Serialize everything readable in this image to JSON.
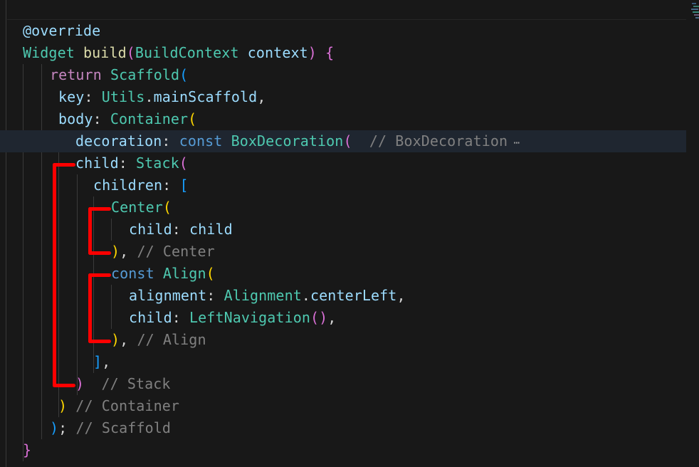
{
  "editor": {
    "language": "dart",
    "lines": [
      {
        "tokens": [
          {
            "t": "@override",
            "c": "ann"
          }
        ]
      },
      {
        "tokens": [
          {
            "t": "Widget",
            "c": "ty"
          },
          {
            "t": " ",
            "c": "pl"
          },
          {
            "t": "build",
            "c": "fn"
          },
          {
            "t": "(",
            "c": "b2"
          },
          {
            "t": "BuildContext",
            "c": "ty"
          },
          {
            "t": " ",
            "c": "pl"
          },
          {
            "t": "context",
            "c": "id"
          },
          {
            "t": ")",
            "c": "b2"
          },
          {
            "t": " ",
            "c": "pl"
          },
          {
            "t": "{",
            "c": "b2"
          }
        ]
      },
      {
        "tokens": [
          {
            "t": "return",
            "c": "kw"
          },
          {
            "t": " ",
            "c": "pl"
          },
          {
            "t": "Scaffold",
            "c": "ty"
          },
          {
            "t": "(",
            "c": "b3"
          }
        ]
      },
      {
        "tokens": [
          {
            "t": "key",
            "c": "id"
          },
          {
            "t": ": ",
            "c": "pl"
          },
          {
            "t": "Utils",
            "c": "ty"
          },
          {
            "t": ".",
            "c": "pl"
          },
          {
            "t": "mainScaffold",
            "c": "id"
          },
          {
            "t": ",",
            "c": "pl"
          }
        ]
      },
      {
        "tokens": [
          {
            "t": "body",
            "c": "id"
          },
          {
            "t": ": ",
            "c": "pl"
          },
          {
            "t": "Container",
            "c": "ty"
          },
          {
            "t": "(",
            "c": "b1"
          }
        ]
      },
      {
        "tokens": [
          {
            "t": "decoration",
            "c": "id"
          },
          {
            "t": ": ",
            "c": "pl"
          },
          {
            "t": "const",
            "c": "kc"
          },
          {
            "t": " ",
            "c": "pl"
          },
          {
            "t": "BoxDecoration",
            "c": "ty"
          },
          {
            "t": "(",
            "c": "b2"
          },
          {
            "t": "  // BoxDecoration",
            "c": "cm"
          },
          {
            "t": " ⋯",
            "c": "ell"
          }
        ]
      },
      {
        "tokens": [
          {
            "t": "child",
            "c": "id"
          },
          {
            "t": ": ",
            "c": "pl"
          },
          {
            "t": "Stack",
            "c": "ty"
          },
          {
            "t": "(",
            "c": "b2"
          }
        ]
      },
      {
        "tokens": [
          {
            "t": "children",
            "c": "id"
          },
          {
            "t": ": ",
            "c": "pl"
          },
          {
            "t": "[",
            "c": "b3"
          }
        ]
      },
      {
        "tokens": [
          {
            "t": "Center",
            "c": "ty"
          },
          {
            "t": "(",
            "c": "b1"
          }
        ]
      },
      {
        "tokens": [
          {
            "t": "child",
            "c": "id"
          },
          {
            "t": ": ",
            "c": "pl"
          },
          {
            "t": "child",
            "c": "id"
          }
        ]
      },
      {
        "tokens": [
          {
            "t": ")",
            "c": "b1"
          },
          {
            "t": ", ",
            "c": "pl"
          },
          {
            "t": "// Center",
            "c": "cm"
          }
        ]
      },
      {
        "tokens": [
          {
            "t": "const",
            "c": "kc"
          },
          {
            "t": " ",
            "c": "pl"
          },
          {
            "t": "Align",
            "c": "ty"
          },
          {
            "t": "(",
            "c": "b1"
          }
        ]
      },
      {
        "tokens": [
          {
            "t": "alignment",
            "c": "id"
          },
          {
            "t": ": ",
            "c": "pl"
          },
          {
            "t": "Alignment",
            "c": "ty"
          },
          {
            "t": ".",
            "c": "pl"
          },
          {
            "t": "centerLeft",
            "c": "id"
          },
          {
            "t": ",",
            "c": "pl"
          }
        ]
      },
      {
        "tokens": [
          {
            "t": "child",
            "c": "id"
          },
          {
            "t": ": ",
            "c": "pl"
          },
          {
            "t": "LeftNavigation",
            "c": "ty"
          },
          {
            "t": "()",
            "c": "b2"
          },
          {
            "t": ",",
            "c": "pl"
          }
        ]
      },
      {
        "tokens": [
          {
            "t": ")",
            "c": "b1"
          },
          {
            "t": ", ",
            "c": "pl"
          },
          {
            "t": "// Align",
            "c": "cm"
          }
        ]
      },
      {
        "tokens": [
          {
            "t": "]",
            "c": "b3"
          },
          {
            "t": ",",
            "c": "pl"
          }
        ]
      },
      {
        "tokens": [
          {
            "t": ")",
            "c": "b2"
          },
          {
            "t": "  // Stack",
            "c": "cm"
          }
        ]
      },
      {
        "tokens": [
          {
            "t": ")",
            "c": "b1"
          },
          {
            "t": " // Container",
            "c": "cm"
          }
        ]
      },
      {
        "tokens": [
          {
            "t": ")",
            "c": "b3"
          },
          {
            "t": ";",
            "c": "pl"
          },
          {
            "t": " // Scaffold",
            "c": "cm"
          }
        ]
      },
      {
        "tokens": [
          {
            "t": "}",
            "c": "b2"
          }
        ]
      }
    ],
    "highlighted_line": 5,
    "folded_region_label": "BoxDecoration"
  },
  "annotations": {
    "bracket_color": "#ff0000",
    "brackets": [
      {
        "label": "stack-bracket",
        "from_line": 6,
        "to_line": 16
      },
      {
        "label": "center-bracket",
        "from_line": 8,
        "to_line": 10
      },
      {
        "label": "align-bracket",
        "from_line": 11,
        "to_line": 14
      }
    ]
  }
}
